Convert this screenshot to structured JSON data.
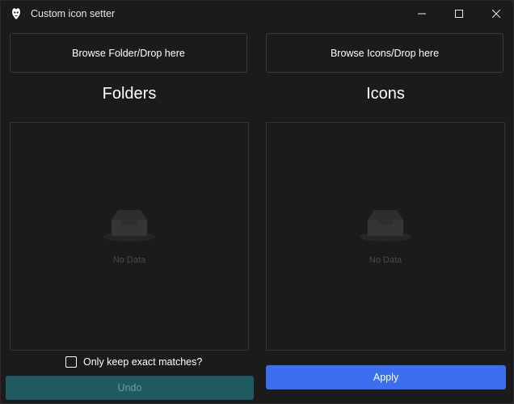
{
  "window": {
    "title": "Custom icon setter",
    "app_icon": "app-logo-icon",
    "controls": {
      "minimize_icon": "minimize-icon",
      "maximize_icon": "maximize-icon",
      "close_icon": "close-icon"
    }
  },
  "folders": {
    "browse_label": "Browse Folder/Drop here",
    "heading": "Folders",
    "empty_text": "No Data",
    "empty_icon": "empty-inbox-icon",
    "exact_match_label": "Only keep exact matches?",
    "exact_match_checked": false,
    "undo_label": "Undo",
    "undo_enabled": false
  },
  "icons": {
    "browse_label": "Browse Icons/Drop here",
    "heading": "Icons",
    "empty_text": "No Data",
    "empty_icon": "empty-inbox-icon",
    "apply_label": "Apply"
  },
  "colors": {
    "background": "#1b1b1b",
    "accent": "#3b6ff0",
    "undo_disabled_bg": "#1e5a60",
    "undo_disabled_text": "#6a9fa3"
  }
}
